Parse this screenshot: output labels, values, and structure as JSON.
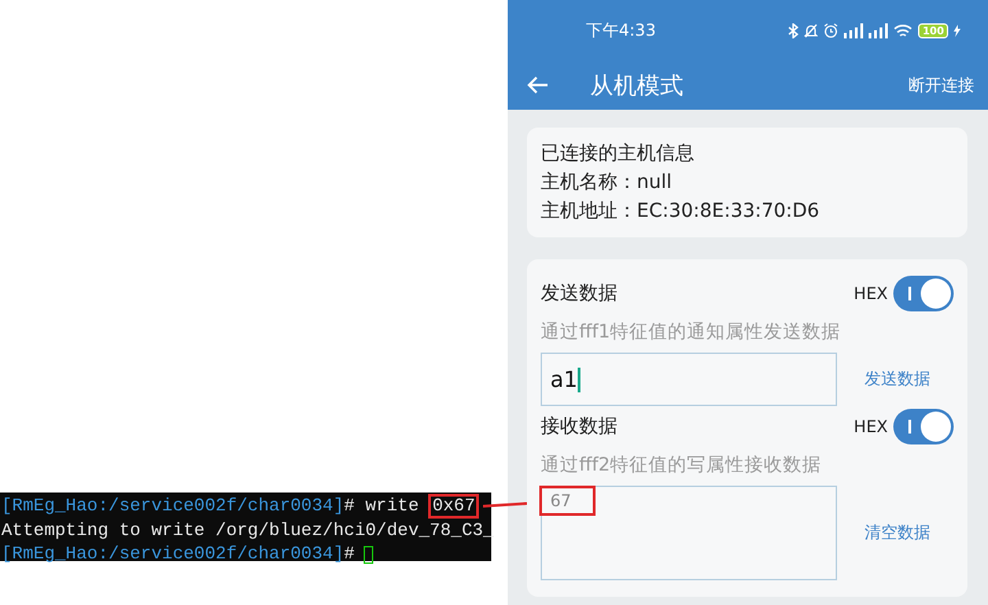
{
  "terminal": {
    "lines": [
      {
        "kind": "command",
        "prompt": "[RmEg_Hao:/service002f/char0034]",
        "text": "# write",
        "argument": "0x67"
      },
      {
        "kind": "output",
        "text": "Attempting to write /org/bluez/hci0/dev_78_C3_"
      },
      {
        "kind": "prompt",
        "prompt": "[RmEg_Hao:/service002f/char0034]",
        "text": "#"
      }
    ]
  },
  "phone": {
    "status_bar": {
      "time": "下午4:33",
      "battery": "100"
    },
    "app_bar": {
      "title": "从机模式",
      "action": "断开连接"
    },
    "host_card": {
      "title": "已连接的主机信息",
      "lines": [
        "主机名称：null",
        "主机地址：EC:30:8E:33:70:D6"
      ]
    },
    "sections": [
      {
        "kind": "send",
        "heading": "发送数据",
        "hex_label": "HEX",
        "hex_on": true,
        "hint": "通过fff1特征值的通知属性发送数据",
        "value": "a1",
        "button": "发送数据"
      },
      {
        "kind": "receive",
        "heading": "接收数据",
        "hex_label": "HEX",
        "hex_on": true,
        "hint": "通过fff2特征值的写属性接收数据",
        "value": "67",
        "button": "清空数据"
      }
    ]
  }
}
